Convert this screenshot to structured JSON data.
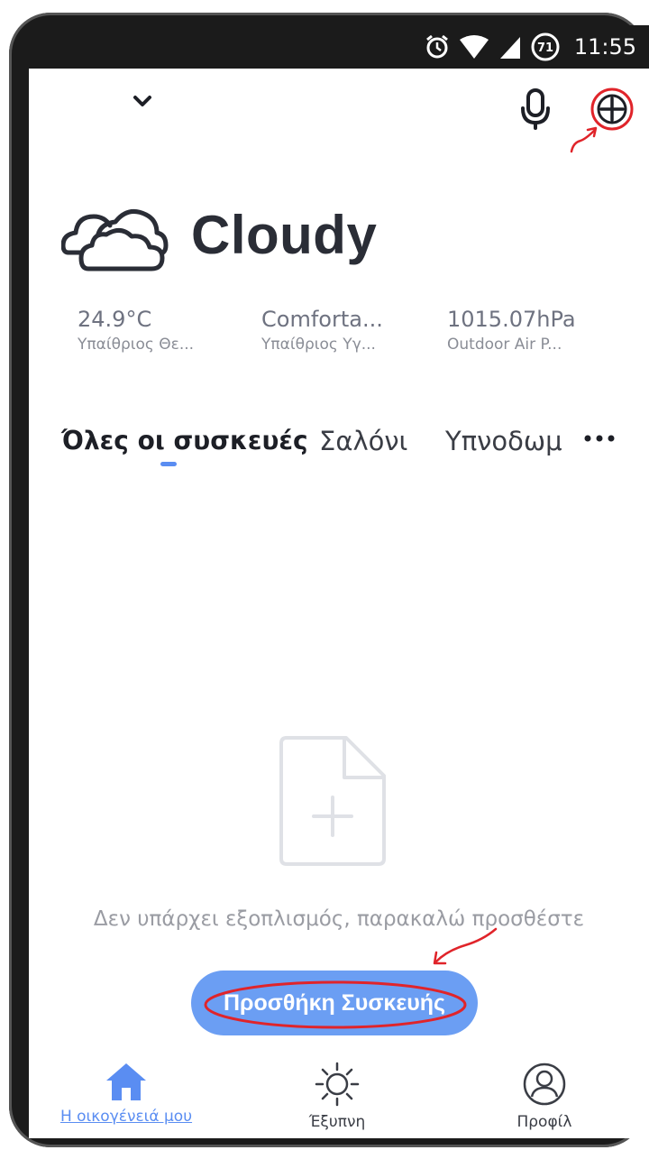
{
  "status_bar": {
    "time": "11:55",
    "battery_level": "71",
    "icons": [
      "alarm-icon",
      "wifi-icon",
      "signal-icon",
      "battery-icon"
    ]
  },
  "header": {
    "icons": [
      "chevron-down-icon",
      "microphone-icon",
      "add-icon"
    ]
  },
  "weather": {
    "condition": "Cloudy",
    "icon": "cloudy-icon",
    "metrics": [
      {
        "value": "24.9°C",
        "label": "Υπαίθριος Θε..."
      },
      {
        "value": "Comforta...",
        "label": "Υπαίθριος Υγ..."
      },
      {
        "value": "1015.07hPa",
        "label": "Outdoor Air P..."
      }
    ]
  },
  "tabs": [
    {
      "label": "Όλες οι συσκευές",
      "active": true
    },
    {
      "label": "Σαλόνι",
      "active": false
    },
    {
      "label": "Υπνοδωμ",
      "active": false
    }
  ],
  "empty_state": {
    "icon": "add-file-icon",
    "message": "Δεν υπάρχει εξοπλισμός, παρακαλώ προσθέστε",
    "button_label": "Προσθήκη Συσκευής"
  },
  "bottom_nav": [
    {
      "label": "Η οικογένειά μου",
      "icon": "home-icon",
      "active": true
    },
    {
      "label": "Έξυπνη",
      "icon": "sun-icon",
      "active": false
    },
    {
      "label": "Προφίλ",
      "icon": "profile-icon",
      "active": false
    }
  ],
  "colors": {
    "accent": "#5a8df2",
    "button": "#6b9ef3",
    "annotation": "#e0242a"
  }
}
